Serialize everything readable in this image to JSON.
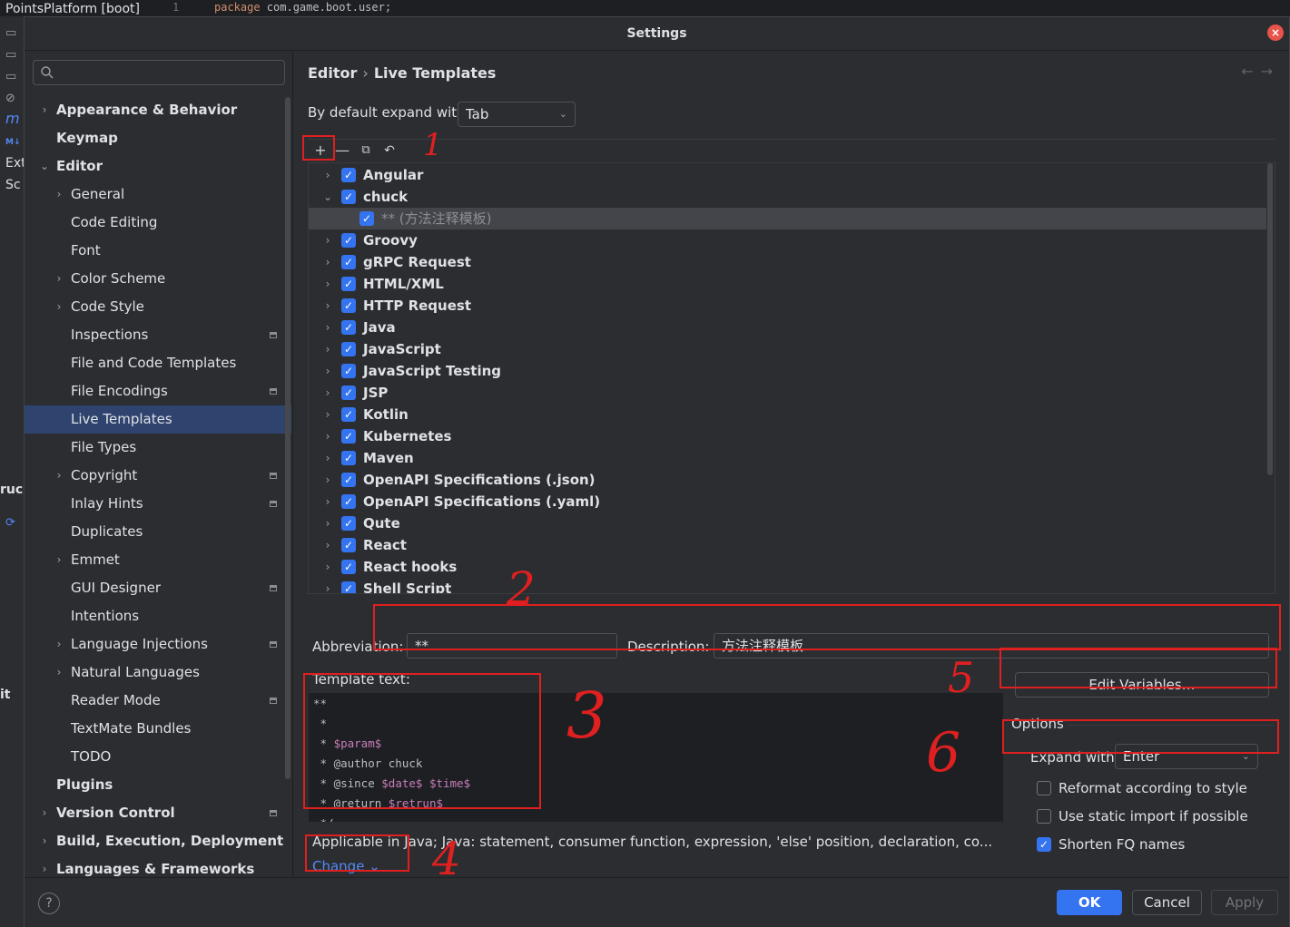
{
  "background": {
    "project": "PointsPlatform [boot]",
    "line_number": "1",
    "code_keyword": "package",
    "code_rest": " com.game.boot.user;",
    "side_texts": [
      "Ext",
      "Sc",
      "ruc",
      "it"
    ]
  },
  "dialog": {
    "title": "Settings",
    "close": "×"
  },
  "search": {
    "placeholder": ""
  },
  "tree": [
    {
      "label": "Appearance & Behavior",
      "level": 0,
      "arrow": "›",
      "bold": true
    },
    {
      "label": "Keymap",
      "level": 0,
      "arrow": "",
      "bold": true
    },
    {
      "label": "Editor",
      "level": 0,
      "arrow": "⌄",
      "bold": true
    },
    {
      "label": "General",
      "level": 1,
      "arrow": "›"
    },
    {
      "label": "Code Editing",
      "level": 1,
      "arrow": ""
    },
    {
      "label": "Font",
      "level": 1,
      "arrow": ""
    },
    {
      "label": "Color Scheme",
      "level": 1,
      "arrow": "›"
    },
    {
      "label": "Code Style",
      "level": 1,
      "arrow": "›"
    },
    {
      "label": "Inspections",
      "level": 1,
      "arrow": "",
      "badge": true
    },
    {
      "label": "File and Code Templates",
      "level": 1,
      "arrow": ""
    },
    {
      "label": "File Encodings",
      "level": 1,
      "arrow": "",
      "badge": true
    },
    {
      "label": "Live Templates",
      "level": 1,
      "arrow": "",
      "selected": true
    },
    {
      "label": "File Types",
      "level": 1,
      "arrow": ""
    },
    {
      "label": "Copyright",
      "level": 1,
      "arrow": "›",
      "badge": true
    },
    {
      "label": "Inlay Hints",
      "level": 1,
      "arrow": "",
      "badge": true
    },
    {
      "label": "Duplicates",
      "level": 1,
      "arrow": ""
    },
    {
      "label": "Emmet",
      "level": 1,
      "arrow": "›"
    },
    {
      "label": "GUI Designer",
      "level": 1,
      "arrow": "",
      "badge": true
    },
    {
      "label": "Intentions",
      "level": 1,
      "arrow": ""
    },
    {
      "label": "Language Injections",
      "level": 1,
      "arrow": "›",
      "badge": true
    },
    {
      "label": "Natural Languages",
      "level": 1,
      "arrow": "›"
    },
    {
      "label": "Reader Mode",
      "level": 1,
      "arrow": "",
      "badge": true
    },
    {
      "label": "TextMate Bundles",
      "level": 1,
      "arrow": ""
    },
    {
      "label": "TODO",
      "level": 1,
      "arrow": ""
    },
    {
      "label": "Plugins",
      "level": 0,
      "arrow": "",
      "bold": true
    },
    {
      "label": "Version Control",
      "level": 0,
      "arrow": "›",
      "bold": true,
      "badge": true
    },
    {
      "label": "Build, Execution, Deployment",
      "level": 0,
      "arrow": "›",
      "bold": true
    },
    {
      "label": "Languages & Frameworks",
      "level": 0,
      "arrow": "›",
      "bold": true
    }
  ],
  "breadcrumb": {
    "parent": "Editor",
    "sep": "›",
    "current": "Live Templates"
  },
  "expand": {
    "label": "By default expand with",
    "value": "Tab"
  },
  "templates": [
    {
      "label": "Angular",
      "arrow": "›"
    },
    {
      "label": "chuck",
      "arrow": "⌄"
    },
    {
      "label": "** (方法注释模板)",
      "arrow": "",
      "child": true,
      "selected": true
    },
    {
      "label": "Groovy",
      "arrow": "›"
    },
    {
      "label": "gRPC Request",
      "arrow": "›"
    },
    {
      "label": "HTML/XML",
      "arrow": "›"
    },
    {
      "label": "HTTP Request",
      "arrow": "›"
    },
    {
      "label": "Java",
      "arrow": "›"
    },
    {
      "label": "JavaScript",
      "arrow": "›"
    },
    {
      "label": "JavaScript Testing",
      "arrow": "›"
    },
    {
      "label": "JSP",
      "arrow": "›"
    },
    {
      "label": "Kotlin",
      "arrow": "›"
    },
    {
      "label": "Kubernetes",
      "arrow": "›"
    },
    {
      "label": "Maven",
      "arrow": "›"
    },
    {
      "label": "OpenAPI Specifications (.json)",
      "arrow": "›"
    },
    {
      "label": "OpenAPI Specifications (.yaml)",
      "arrow": "›"
    },
    {
      "label": "Qute",
      "arrow": "›"
    },
    {
      "label": "React",
      "arrow": "›"
    },
    {
      "label": "React hooks",
      "arrow": "›"
    },
    {
      "label": "Shell Script",
      "arrow": "›"
    }
  ],
  "editor": {
    "abbreviation_label": "Abbreviation:",
    "abbreviation_value": "**",
    "description_label": "Description:",
    "description_value": "方法注释模板",
    "template_text_label": "Template text:",
    "template_lines": [
      [
        {
          "t": "**"
        }
      ],
      [
        {
          "t": " *"
        }
      ],
      [
        {
          "t": " * "
        },
        {
          "t": "$param$",
          "v": true
        }
      ],
      [
        {
          "t": " * @author chuck"
        }
      ],
      [
        {
          "t": " * @since "
        },
        {
          "t": "$date$",
          "v": true
        },
        {
          "t": " "
        },
        {
          "t": "$time$",
          "v": true
        }
      ],
      [
        {
          "t": " * @return "
        },
        {
          "t": "$retrun$",
          "v": true
        }
      ],
      [
        {
          "t": " */"
        }
      ]
    ],
    "applicable": "Applicable in Java; Java: statement, consumer function, expression, 'else' position, declaration, co...",
    "change_link": "Change ⌄",
    "edit_variables": "Edit Variables…",
    "options_label": "Options",
    "expand_with_label": "Expand with",
    "expand_with_value": "Enter",
    "reformat": "Reformat according to style",
    "static_import": "Use static import if possible",
    "shorten_fq": "Shorten FQ names"
  },
  "options_state": {
    "reformat": false,
    "static_import": false,
    "shorten_fq": true
  },
  "footer": {
    "help": "?",
    "ok": "OK",
    "cancel": "Cancel",
    "apply": "Apply"
  },
  "annotations": [
    "1",
    "2",
    "3",
    "4",
    "5",
    "6"
  ],
  "colors": {
    "accent": "#3574f0",
    "selection": "#2e436e",
    "annotation": "#e02020",
    "template_var": "#c77dbb"
  }
}
